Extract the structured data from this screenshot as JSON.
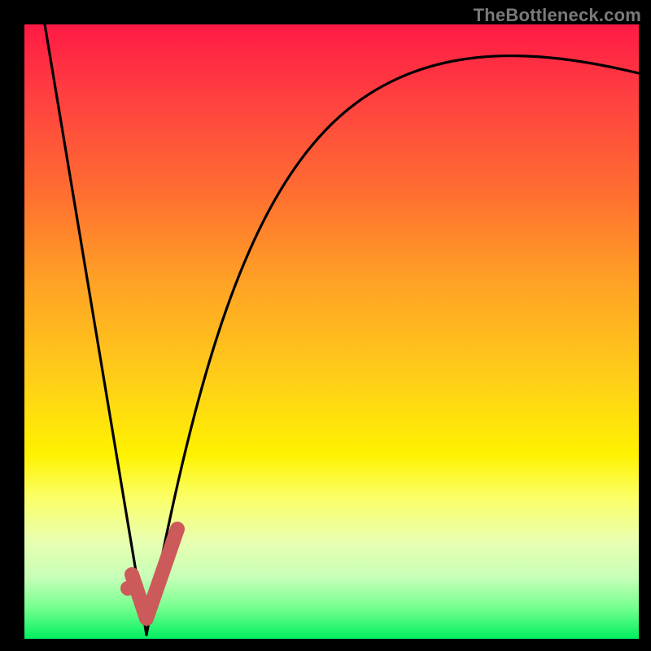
{
  "watermark": "TheBottleneck.com",
  "colors": {
    "gradient_top": "#ff1a45",
    "gradient_mid": "#fff200",
    "gradient_bottom": "#00f060",
    "curve_stroke": "#000000",
    "marker_stroke": "#cc5a5a",
    "marker_fill": "#cc5a5a",
    "frame": "#000000"
  },
  "chart_data": {
    "type": "line",
    "title": "",
    "xlabel": "",
    "ylabel": "",
    "xlim": [
      0,
      100
    ],
    "ylim": [
      0,
      100
    ],
    "grid": false,
    "note": "Axes are implicit (no ticks shown). y is bottleneck % (top=100, bottom=0). x is a component-performance axis. Values below are read off the curve shapes in percent of plot width/height.",
    "series": [
      {
        "name": "left-branch",
        "x": [
          3,
          6,
          9,
          12,
          15,
          18,
          20
        ],
        "values": [
          100,
          83,
          66,
          50,
          33,
          14,
          0
        ]
      },
      {
        "name": "right-branch",
        "x": [
          20,
          23,
          26,
          30,
          35,
          42,
          50,
          60,
          72,
          85,
          100
        ],
        "values": [
          0,
          20,
          38,
          55,
          67,
          76,
          82,
          86,
          89,
          91,
          92
        ]
      }
    ],
    "marker": {
      "name": "optimum-check",
      "dot": {
        "x": 17,
        "y": 8
      },
      "check_points_xy": [
        [
          17.5,
          10
        ],
        [
          19.5,
          3
        ],
        [
          24.5,
          18
        ]
      ],
      "color": "#cc5a5a"
    }
  }
}
